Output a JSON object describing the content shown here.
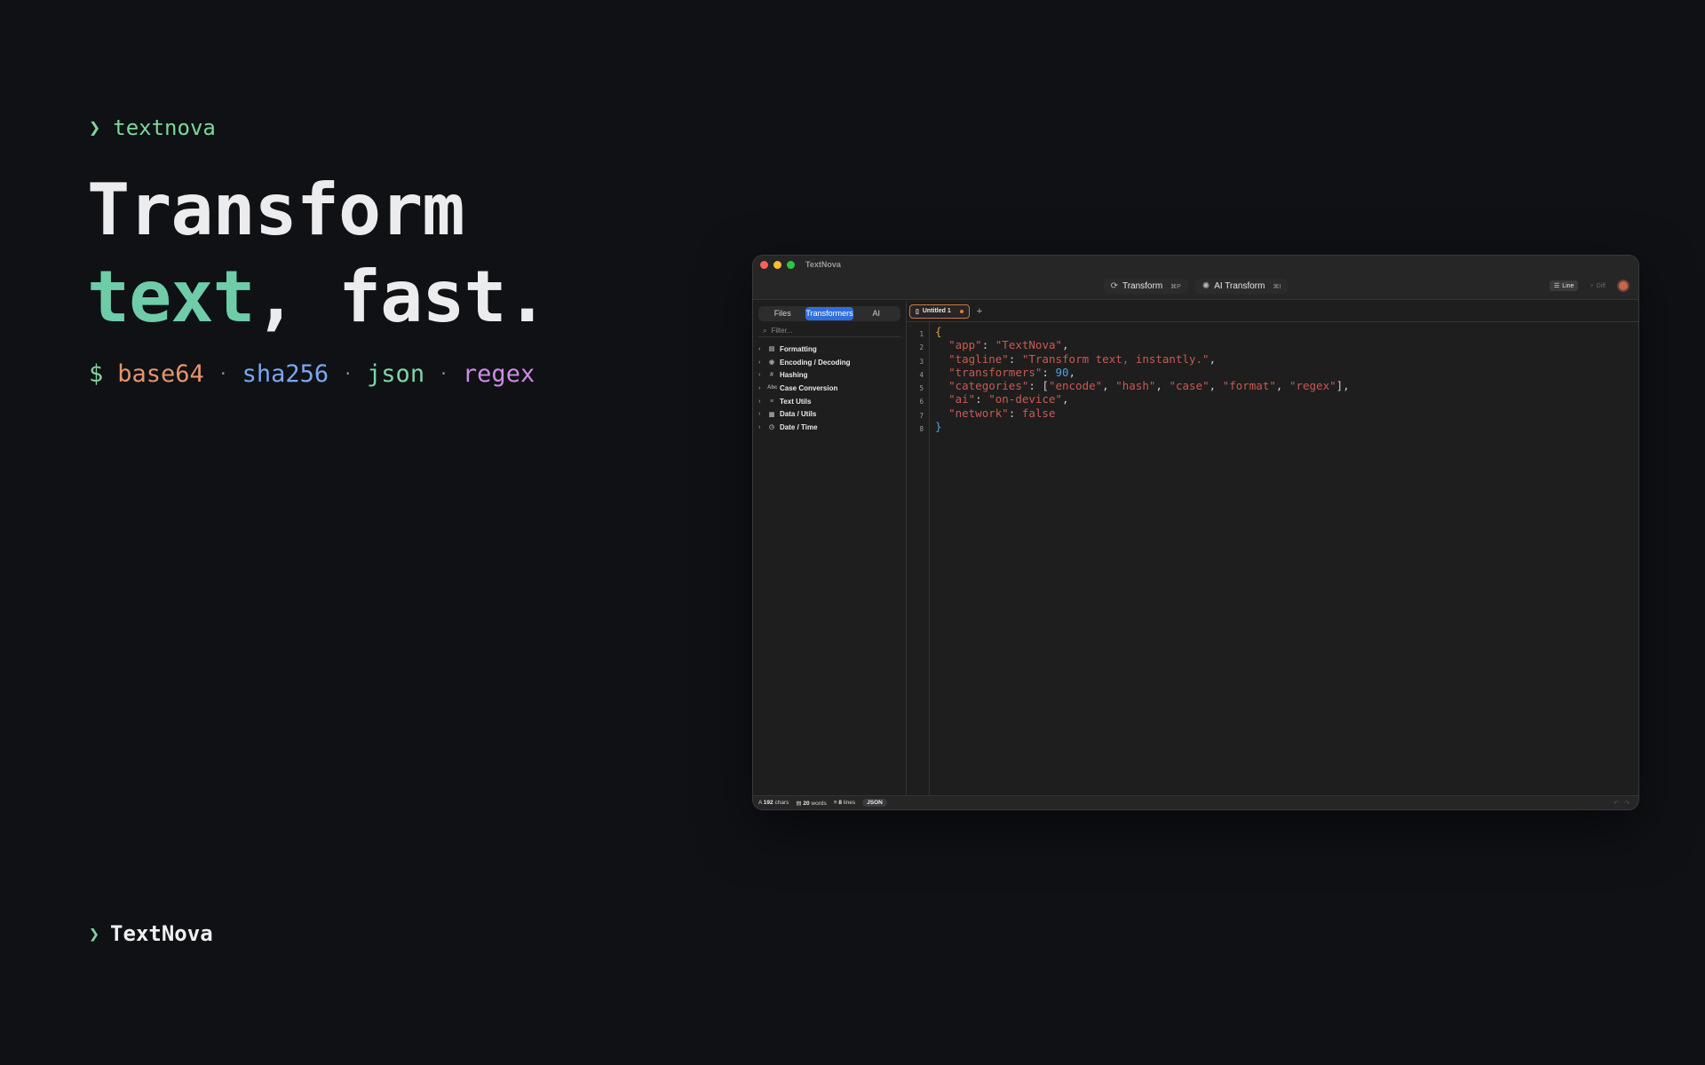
{
  "hero": {
    "brand_chevron": "❯",
    "brand_name": "textnova",
    "headline_line1": "Transform",
    "headline_accent": "text",
    "headline_rest": ", fast.",
    "prompt_symbol": "$",
    "commands": [
      {
        "label": "base64",
        "color": "#e6956a"
      },
      {
        "label": "sha256",
        "color": "#7aa7f0"
      },
      {
        "label": "json",
        "color": "#7ed6a8"
      },
      {
        "label": "regex",
        "color": "#d08ae6"
      }
    ],
    "separator": "·",
    "footer_chevron": "❯",
    "footer_brand": "TextNova"
  },
  "window": {
    "title": "TextNova",
    "toolbar": {
      "transform_label": "Transform",
      "transform_shortcut": "⌘P",
      "ai_transform_label": "AI Transform",
      "ai_transform_shortcut": "⌘I",
      "line_label": "Line",
      "diff_label": "Diff"
    },
    "sidebar": {
      "segments": [
        "Files",
        "Transformers",
        "AI"
      ],
      "active_segment": "Transformers",
      "filter_placeholder": "Filter...",
      "items": [
        {
          "label": "Formatting",
          "icon": "document-icon",
          "glyph": "▤"
        },
        {
          "label": "Encoding / Decoding",
          "icon": "encoding-icon",
          "glyph": "◉"
        },
        {
          "label": "Hashing",
          "icon": "hash-icon",
          "glyph": "#"
        },
        {
          "label": "Case Conversion",
          "icon": "case-icon",
          "glyph": "Abc"
        },
        {
          "label": "Text Utils",
          "icon": "text-lines-icon",
          "glyph": "≡"
        },
        {
          "label": "Data / Utils",
          "icon": "table-icon",
          "glyph": "▦"
        },
        {
          "label": "Date / Time",
          "icon": "clock-icon",
          "glyph": "◷"
        }
      ]
    },
    "tabs": [
      {
        "label": "Untitled 1",
        "modified": true
      }
    ],
    "editor": {
      "line_numbers": [
        "1",
        "2",
        "3",
        "4",
        "5",
        "6",
        "7",
        "8"
      ]
    },
    "status": {
      "chars": "192",
      "chars_label": "chars",
      "words": "20",
      "words_label": "words",
      "lines": "8",
      "lines_label": "lines",
      "language": "JSON"
    }
  }
}
